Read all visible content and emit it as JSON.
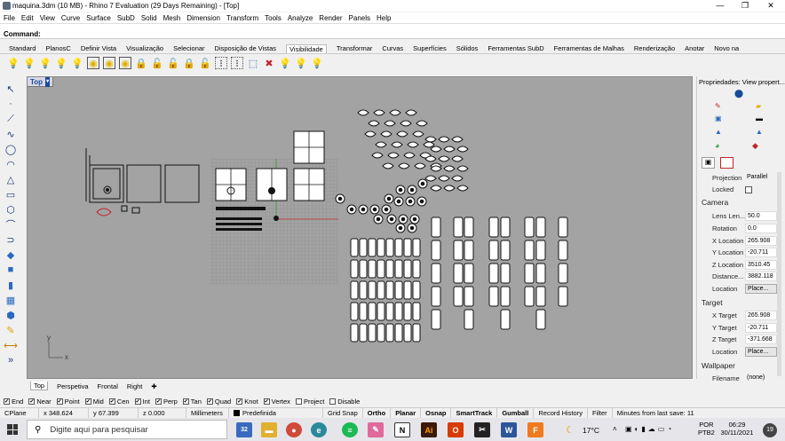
{
  "window": {
    "title": "maquina.3dm (10 MB) - Rhino 7 Evaluation (29 Days Remaining) - [Top]",
    "minimize": "—",
    "maximize": "❐",
    "close": "✕"
  },
  "menu": [
    "File",
    "Edit",
    "View",
    "Curve",
    "Surface",
    "SubD",
    "Solid",
    "Mesh",
    "Dimension",
    "Transform",
    "Tools",
    "Analyze",
    "Render",
    "Panels",
    "Help"
  ],
  "command": {
    "label": "Command:"
  },
  "toolbar_tabs": [
    "Standard",
    "PlanosC",
    "Definir Vista",
    "Visualização",
    "Selecionar",
    "Disposição de Vistas",
    "Visibilidade",
    "Transformar",
    "Curvas",
    "Superfícies",
    "Sólidos",
    "Ferramentas SubD",
    "Ferramentas de Malhas",
    "Renderização",
    "Anotar",
    "Novo na"
  ],
  "active_tab_index": 6,
  "viewport": {
    "label": "Top",
    "axis_x": "x",
    "axis_y": "y"
  },
  "view_tabs": [
    "Top",
    "Perspetiva",
    "Frontal",
    "Right"
  ],
  "view_tab_add": "✚",
  "osnaps": [
    {
      "label": "End",
      "checked": true
    },
    {
      "label": "Near",
      "checked": true
    },
    {
      "label": "Point",
      "checked": true
    },
    {
      "label": "Mid",
      "checked": true
    },
    {
      "label": "Cen",
      "checked": true
    },
    {
      "label": "Int",
      "checked": true
    },
    {
      "label": "Perp",
      "checked": true
    },
    {
      "label": "Tan",
      "checked": true
    },
    {
      "label": "Quad",
      "checked": true
    },
    {
      "label": "Knot",
      "checked": true
    },
    {
      "label": "Vertex",
      "checked": true
    },
    {
      "label": "Project",
      "checked": false
    },
    {
      "label": "Disable",
      "checked": false
    }
  ],
  "status": {
    "cplane": "CPlane",
    "x": "x 348.624",
    "y": "y 67.399",
    "z": "z 0.000",
    "units": "Millimeters",
    "layer": "Predefinida",
    "grid_snap": "Grid Snap",
    "ortho": "Ortho",
    "planar": "Planar",
    "osnap": "Osnap",
    "smarttrack": "SmartTrack",
    "gumball": "Gumball",
    "record": "Record History",
    "filter": "Filter",
    "minutes": "Minutes from last save: 11"
  },
  "properties": {
    "title": "Propriedades: View propert...",
    "projection_label": "Projection",
    "projection_value": "Parallel",
    "locked_label": "Locked",
    "camera_header": "Camera",
    "lens_label": "Lens Len...",
    "lens_value": "50.0",
    "rotation_label": "Rotation",
    "rotation_value": "0.0",
    "xloc_label": "X Location",
    "xloc_value": "265.908",
    "yloc_label": "Y Location",
    "yloc_value": "-20.711",
    "zloc_label": "Z Location",
    "zloc_value": "3510.45",
    "distance_label": "Distance...",
    "distance_value": "3882.118",
    "location_label": "Location",
    "place_label": "Place...",
    "target_header": "Target",
    "tx_label": "X Target",
    "tx_value": "265.908",
    "ty_label": "Y Target",
    "ty_value": "-20.711",
    "tz_label": "Z Target",
    "tz_value": "-371.668",
    "tloc_label": "Location",
    "tplace_label": "Place...",
    "wallpaper_header": "Wallpaper",
    "filename_label": "Filename",
    "filename_value": "(none)"
  },
  "taskbar": {
    "search_placeholder": "Digite aqui para pesquisar",
    "badge": "32",
    "weather": "17°C",
    "lang": "POR",
    "layout": "PTB2",
    "time": "06:29",
    "date": "30/11/2021",
    "notifications": "19"
  },
  "colors": {
    "viewport_bg": "#a3a3a3",
    "grid": "#8c8c8c",
    "accent_red": "#c0262b",
    "accent_blue": "#1a4a9a"
  }
}
